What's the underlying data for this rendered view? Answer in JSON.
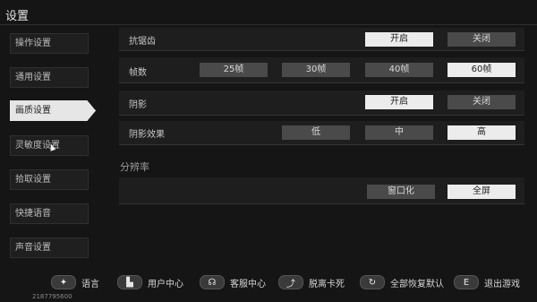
{
  "page_title": "设置",
  "sidebar": {
    "items": [
      {
        "label": "操作设置",
        "active": false
      },
      {
        "label": "通用设置",
        "active": false
      },
      {
        "label": "画质设置",
        "active": true
      },
      {
        "label": "灵敏度设置",
        "active": false
      },
      {
        "label": "拾取设置",
        "active": false
      },
      {
        "label": "快捷语音",
        "active": false
      },
      {
        "label": "声音设置",
        "active": false
      }
    ]
  },
  "settings": {
    "antialias": {
      "label": "抗锯齿",
      "options": [
        "开启",
        "关闭"
      ],
      "selected": "开启"
    },
    "fps": {
      "label": "帧数",
      "options": [
        "25帧",
        "30帧",
        "40帧",
        "60帧"
      ],
      "selected": "60帧"
    },
    "shadow": {
      "label": "阴影",
      "options": [
        "开启",
        "关闭"
      ],
      "selected": "开启"
    },
    "shadow_quality": {
      "label": "阴影效果",
      "options": [
        "低",
        "中",
        "高"
      ],
      "selected": "高"
    },
    "resolution_section": "分辨率",
    "display_mode": {
      "options": [
        "窗口化",
        "全屏"
      ],
      "selected": "全屏"
    }
  },
  "footer": {
    "items": [
      {
        "label": "语言",
        "icon": "language-icon",
        "glyph": "✦"
      },
      {
        "label": "用户中心",
        "icon": "user-center-icon",
        "glyph": "▙"
      },
      {
        "label": "客服中心",
        "icon": "customer-service-icon",
        "glyph": "☊"
      },
      {
        "label": "脱离卡死",
        "icon": "unstuck-icon",
        "glyph": "⤴"
      },
      {
        "label": "全部恢复默认",
        "icon": "restore-default-icon",
        "glyph": "↻"
      },
      {
        "label": "退出游戏",
        "icon": "exit-game-icon",
        "glyph": "E"
      }
    ]
  },
  "user_id": "2187795600"
}
